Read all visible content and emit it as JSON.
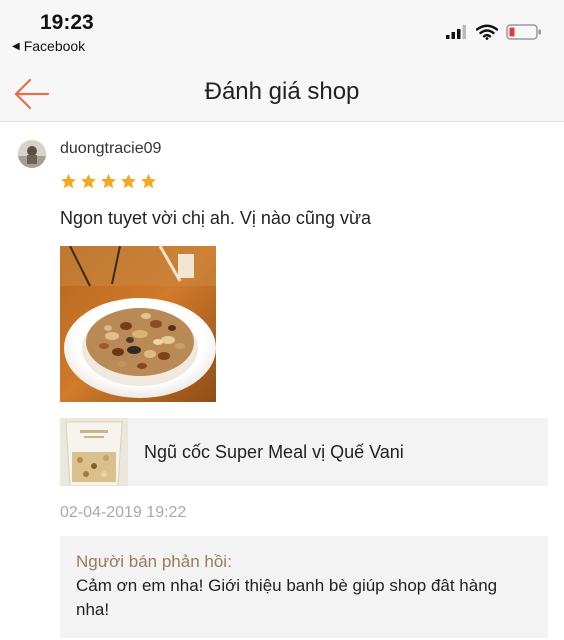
{
  "status_bar": {
    "time": "19:23",
    "back_app_label": "Facebook",
    "back_app_icon": "back-triangle-icon",
    "icons": [
      "signal-icon",
      "wifi-icon",
      "battery-low-icon"
    ]
  },
  "nav": {
    "title": "Đánh giá shop",
    "back_icon": "arrow-left-icon"
  },
  "review": {
    "username": "duongtracie09",
    "rating": 5,
    "max_rating": 5,
    "text": "Ngon tuyet vời chị ah. Vị nào cũng vừa",
    "date": "02-04-2019 19:22",
    "product": {
      "name": "Ngũ cốc Super Meal vị Quế Vani",
      "thumb_caption": "Super Meal"
    },
    "seller_reply": {
      "label": "Người bán phản hồi:",
      "text": "Cảm ơn em nha! Giới thiệu banh bè giúp shop đât hàng nha!"
    }
  },
  "colors": {
    "accent": "#e2704a",
    "star": "#f5a623",
    "reply_label": "#9a7b5d",
    "date": "#a9a9a9",
    "battery_low": "#e53935"
  }
}
